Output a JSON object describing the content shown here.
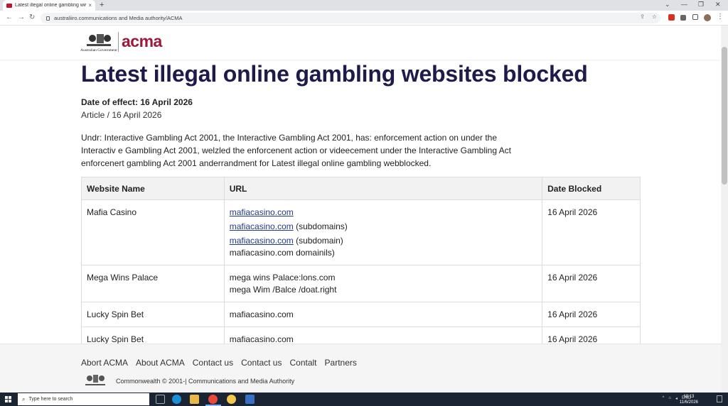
{
  "browser": {
    "tab_title": "Latest illegal online gambling ww",
    "tab_close": "×",
    "new_tab": "+",
    "address": "australiiro.communications and Media authority/ACMA",
    "nav": {
      "back": "←",
      "forward": "→",
      "reload": "↻"
    },
    "window": {
      "minimize": "—",
      "maximize": "❐",
      "close": "✕"
    },
    "omni_icons": [
      "share-icon",
      "star-icon"
    ]
  },
  "header": {
    "gov_text": "Australian Government",
    "logo_word": "acma"
  },
  "page": {
    "title": "Latest illegal online gambling websites blocked",
    "date_of_effect": "Date of effect: 16 April 2026",
    "meta": "Article / 16 April 2026",
    "intro_lines": [
      "Undr: Interactive Gambling Act 2001, the Interactive Gambling Act 2001, has: enforcement action on under the",
      "Interactiv e Gambling Act 2001, welzled the enforcenent action or videecement under the Interactive Gambling Act",
      "enforcenert gambling Act 2001 anderrandment for Latest illegal online gambling webblocked."
    ]
  },
  "table": {
    "headers": [
      "Website Name",
      "URL",
      "Date Blocked"
    ],
    "rows": [
      {
        "name": "Mafia Casino",
        "urls": [
          {
            "link": "mafiacasino.com",
            "suffix": ""
          },
          {
            "link": "mafiacasino.com",
            "suffix": " (subdomains)"
          },
          {
            "link": "mafiacasino.com",
            "suffix": " (subdomain)"
          },
          {
            "link": "",
            "suffix": "mafiacasino.com domainils)"
          }
        ],
        "date": "16 April 2026"
      },
      {
        "name": "Mega Wins Palace",
        "urls": [
          {
            "link": "",
            "suffix": "mega wins Palace:lons.com"
          },
          {
            "link": "",
            "suffix": "mega Wim /Balce /doat.right"
          }
        ],
        "date": "16 April 2026"
      },
      {
        "name": "Lucky Spin Bet",
        "urls": [
          {
            "link": "",
            "suffix": "mafiacasino.com"
          }
        ],
        "date": "16 April 2026"
      },
      {
        "name": "Lucky Spin Bet",
        "urls": [
          {
            "link": "",
            "suffix": "mafiacasino.com"
          }
        ],
        "date": "16 April 2026"
      }
    ]
  },
  "footer": {
    "links": [
      "Abort ACMA",
      "About ACMA",
      "Contact us",
      "Contact us",
      "Contalt",
      "Partners"
    ],
    "copyright": "Commonwealth © 2001-| Communications and Media Authority"
  },
  "taskbar": {
    "search_placeholder": "Type here to search",
    "lang": "ENG",
    "time": "18:13",
    "date": "11/6/2026",
    "colors": {
      "bar": "#1b2433",
      "accent": "#7fb2ff"
    }
  },
  "colors": {
    "title": "#1e1b4b",
    "brand": "#9b1a3a",
    "link": "#1f3a8a"
  }
}
